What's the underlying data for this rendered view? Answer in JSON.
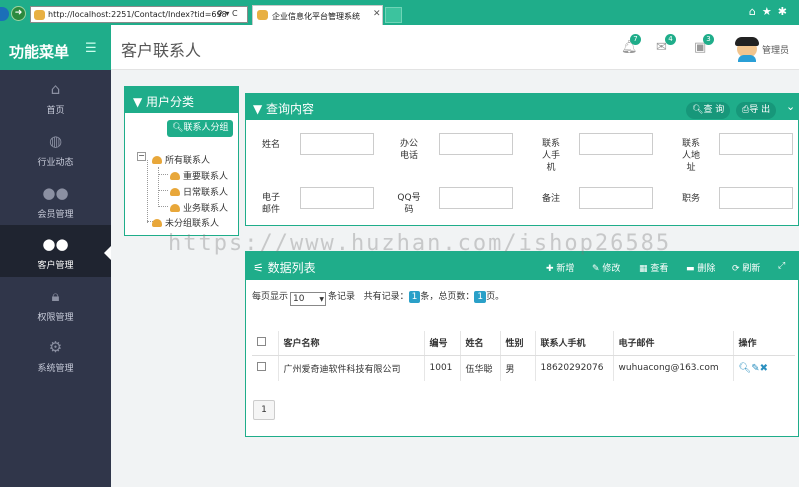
{
  "browser": {
    "address": "http://localhost:2251/Contact/Index?tid=698",
    "address_tools": "♀ ▾ C",
    "tab_title": "企业信息化平台管理系统",
    "tab_close": "✕"
  },
  "sidebar": {
    "title": "功能菜单",
    "items": [
      {
        "label": "首页",
        "icon": "home-icon"
      },
      {
        "label": "行业动态",
        "icon": "globe-icon"
      },
      {
        "label": "会员管理",
        "icon": "users-icon"
      },
      {
        "label": "客户管理",
        "icon": "customers-icon",
        "active": true
      },
      {
        "label": "权限管理",
        "icon": "lock-icon"
      },
      {
        "label": "系统管理",
        "icon": "gear-icon"
      }
    ]
  },
  "header": {
    "title": "客户联系人",
    "notifications": "7",
    "messages": "4",
    "tasks": "3",
    "user": "管理员"
  },
  "category": {
    "title": "用户分类",
    "group_button": "联系人分组",
    "tree": {
      "root": "所有联系人",
      "children": [
        "重要联系人",
        "日常联系人",
        "业务联系人"
      ],
      "ungrouped": "未分组联系人"
    }
  },
  "query": {
    "title": "查询内容",
    "search_button": "查 询",
    "export_button": "导 出",
    "fields": [
      {
        "label": "姓名"
      },
      {
        "label": "办公电话"
      },
      {
        "label": "联系人手机"
      },
      {
        "label": "联系人地址"
      },
      {
        "label": "电子邮件"
      },
      {
        "label": "QQ号码"
      },
      {
        "label": "备注"
      },
      {
        "label": "职务"
      }
    ]
  },
  "list": {
    "title": "数据列表",
    "buttons": {
      "add": "新增",
      "edit": "修改",
      "view": "查看",
      "delete": "删除",
      "refresh": "刷新"
    },
    "page_size_prefix": "每页显示",
    "page_size": "10",
    "page_size_suffix": "条记录",
    "total_prefix": "共有记录：",
    "total_records": "1",
    "total_mid": "条，总页数：",
    "total_pages": "1",
    "total_suffix": "页。",
    "columns": [
      "客户名称",
      "编号",
      "姓名",
      "性别",
      "联系人手机",
      "电子邮件",
      "操作"
    ],
    "rows": [
      {
        "customer": "广州爱奇迪软件科技有限公司",
        "code": "1001",
        "name": "伍华聪",
        "gender": "男",
        "mobile": "18620292076",
        "email": "wuhuacong@163.com"
      }
    ],
    "page": "1"
  },
  "watermark": "https://www.huzhan.com/ishop26585",
  "colors": {
    "accent": "#1fad8a",
    "sidebar": "#30364a"
  }
}
